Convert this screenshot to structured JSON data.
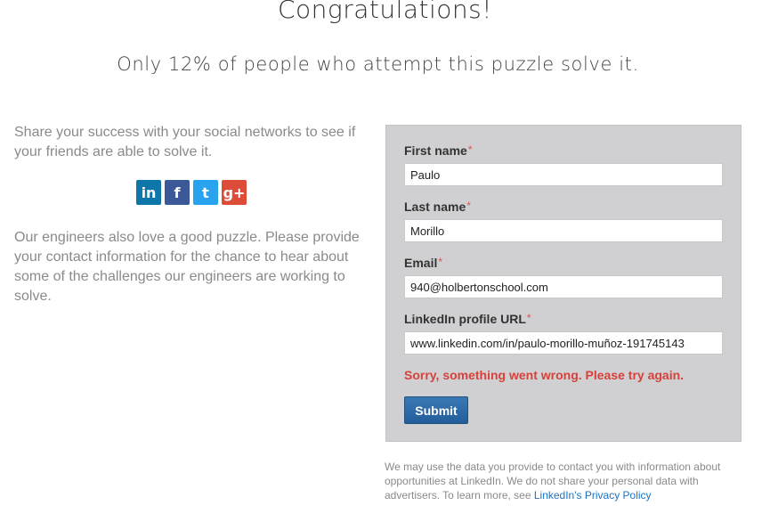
{
  "header": {
    "title": "Congratulations!",
    "subtitle": "Only 12% of people who attempt this puzzle solve it."
  },
  "left": {
    "share_text": "Share your success with your social networks to see if your friends are able to solve it.",
    "engineers_text": "Our engineers also love a good puzzle. Please provide your contact information for the chance to hear about some of the challenges our engineers are working to solve.",
    "social": [
      {
        "name": "linkedin-icon",
        "glyph": "in",
        "color": "#0e76a8"
      },
      {
        "name": "facebook-icon",
        "glyph": "f",
        "color": "#3b5998"
      },
      {
        "name": "twitter-icon",
        "glyph": "t",
        "color": "#2aa3ef"
      },
      {
        "name": "google-plus-icon",
        "glyph": "g+",
        "color": "#dd4b39"
      }
    ]
  },
  "form": {
    "required_marker": "*",
    "first_name": {
      "label": "First name",
      "value": "Paulo"
    },
    "last_name": {
      "label": "Last name",
      "value": "Morillo"
    },
    "email": {
      "label": "Email",
      "value": "940@holbertonschool.com"
    },
    "linkedin": {
      "label": "LinkedIn profile URL",
      "value": "www.linkedin.com/in/paulo-morillo-muñoz-191745143"
    },
    "error": "Sorry, something went wrong. Please try again.",
    "submit_label": "Submit"
  },
  "disclaimer": {
    "text": "We may use the data you provide to contact you with information about opportunities at LinkedIn. We do not share your personal data with advertisers. To learn more, see ",
    "link": "LinkedIn's Privacy Policy"
  }
}
